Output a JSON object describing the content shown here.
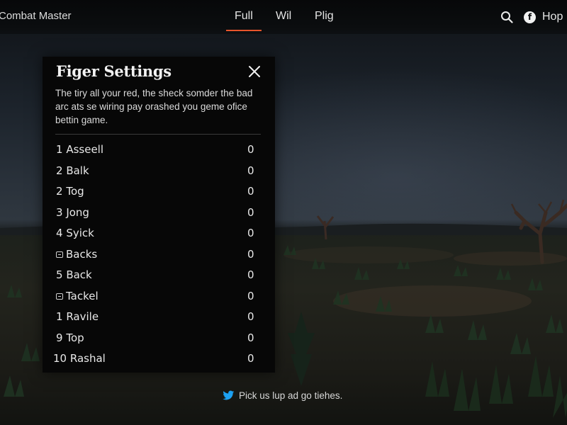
{
  "app": {
    "title": "Combat Master"
  },
  "nav": {
    "tabs": [
      {
        "label": "Full",
        "active": true
      },
      {
        "label": "Wil",
        "active": false
      },
      {
        "label": "Plig",
        "active": false
      }
    ],
    "help_label": "Hop"
  },
  "icons": {
    "search": "search-icon",
    "facebook": "facebook-icon",
    "close": "close-icon",
    "twitter": "twitter-bird-icon",
    "row_glyph": "button-glyph-icon"
  },
  "colors": {
    "accent": "#e8542b",
    "panel_bg": "#070707",
    "twitter": "#1da1f2"
  },
  "panel": {
    "title": "Figer Settings",
    "description": "The tiry all your red, the sheck somder the bad arc ats se wiring pay orashed you geme ofice bettin game.",
    "rows": [
      {
        "prefix": "1",
        "label": "Asseell",
        "value": "0",
        "glyph": false
      },
      {
        "prefix": "2",
        "label": "Balk",
        "value": "0",
        "glyph": false
      },
      {
        "prefix": "2",
        "label": "Tog",
        "value": "0",
        "glyph": false
      },
      {
        "prefix": "3",
        "label": "Jong",
        "value": "0",
        "glyph": false
      },
      {
        "prefix": "4",
        "label": "Syick",
        "value": "0",
        "glyph": false
      },
      {
        "prefix": "",
        "label": "Backs",
        "value": "0",
        "glyph": true
      },
      {
        "prefix": "5",
        "label": "Back",
        "value": "0",
        "glyph": false
      },
      {
        "prefix": "",
        "label": "Tackel",
        "value": "0",
        "glyph": true
      },
      {
        "prefix": "1",
        "label": "Ravile",
        "value": "0",
        "glyph": false
      },
      {
        "prefix": "9",
        "label": "Top",
        "value": "0",
        "glyph": false
      },
      {
        "prefix": "10",
        "label": "Rashal",
        "value": "0",
        "glyph": false
      }
    ]
  },
  "footer": {
    "text": "Pick us lup ad go tiehes."
  }
}
